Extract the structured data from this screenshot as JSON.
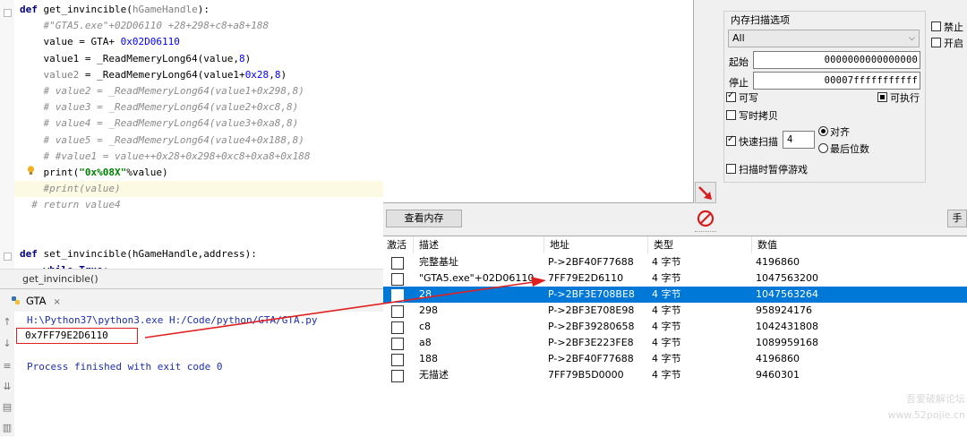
{
  "editor": {
    "lines": [
      [
        {
          "t": "def ",
          "c": "kw"
        },
        {
          "t": "get_invincible",
          "c": ""
        },
        {
          "t": "(",
          "c": ""
        },
        {
          "t": "hGameHandle",
          "c": "gr"
        },
        {
          "t": "):",
          "c": ""
        }
      ],
      [
        {
          "t": "    ",
          "c": ""
        },
        {
          "t": "#\"GTA5.exe\"+02D06110 +28+298+c8+a8+188",
          "c": "cm"
        }
      ],
      [
        {
          "t": "    value = GTA+ ",
          "c": ""
        },
        {
          "t": "0x02D06110",
          "c": "num"
        }
      ],
      [
        {
          "t": "    value1 = _ReadMemeryLong64(value,",
          "c": ""
        },
        {
          "t": "8",
          "c": "num"
        },
        {
          "t": ")",
          "c": ""
        }
      ],
      [
        {
          "t": "    ",
          "c": ""
        },
        {
          "t": "value2",
          "c": "gr"
        },
        {
          "t": " = _ReadMemeryLong64(value1+",
          "c": ""
        },
        {
          "t": "0x28",
          "c": "num"
        },
        {
          "t": ",",
          "c": ""
        },
        {
          "t": "8",
          "c": "num"
        },
        {
          "t": ")",
          "c": ""
        }
      ],
      [
        {
          "t": "    ",
          "c": ""
        },
        {
          "t": "# value2 = _ReadMemeryLong64(value1+0x298,8)",
          "c": "cm"
        }
      ],
      [
        {
          "t": "    ",
          "c": ""
        },
        {
          "t": "# value3 = _ReadMemeryLong64(value2+0xc8,8)",
          "c": "cm"
        }
      ],
      [
        {
          "t": "    ",
          "c": ""
        },
        {
          "t": "# value4 = _ReadMemeryLong64(value3+0xa8,8)",
          "c": "cm"
        }
      ],
      [
        {
          "t": "    ",
          "c": ""
        },
        {
          "t": "# value5 = _ReadMemeryLong64(value4+0x188,8)",
          "c": "cm"
        }
      ],
      [
        {
          "t": "    ",
          "c": ""
        },
        {
          "t": "# #value1 = value++0x28+0x298+0xc8+0xa8+0x188",
          "c": "cm"
        }
      ],
      [
        {
          "t": "    print(",
          "c": ""
        },
        {
          "t": "\"0x%08X\"",
          "c": "str"
        },
        {
          "t": "%value)",
          "c": ""
        }
      ],
      [
        {
          "t": "    ",
          "c": ""
        },
        {
          "t": "#print(value)",
          "c": "cm"
        }
      ],
      [
        {
          "t": "  ",
          "c": ""
        },
        {
          "t": "# return value4",
          "c": "cm"
        }
      ],
      [],
      [],
      [
        {
          "t": "def ",
          "c": "kw"
        },
        {
          "t": "set_invincible(hGameHandle,address):",
          "c": ""
        }
      ],
      [
        {
          "t": "    ",
          "c": ""
        },
        {
          "t": "while",
          "c": "kw"
        },
        {
          "t": " ",
          "c": ""
        },
        {
          "t": "True",
          "c": "kw"
        },
        {
          "t": ":",
          "c": ""
        }
      ]
    ],
    "breadcrumb": "get_invincible()"
  },
  "run": {
    "tab_label": "GTA",
    "tab_close": "×",
    "command": "H:\\Python37\\python3.exe H:/Code/python/GTA/GTA.py",
    "output_value": "0x7FF79E2D6110",
    "exit_message": "Process finished with exit code 0"
  },
  "ce": {
    "scan_options_title": "内存扫描选项",
    "memory_region": "All",
    "start_label": "起始",
    "start_value": "0000000000000000",
    "stop_label": "停止",
    "stop_value": "00007fffffffffff",
    "writable_label": "可写",
    "executable_label": "可执行",
    "copy_on_write_label": "写时拷贝",
    "fast_scan_label": "快速扫描",
    "fast_scan_value": "4",
    "align_label": "对齐",
    "last_digits_label": "最后位数",
    "pause_game_label": "扫描时暂停游戏",
    "disable_label": "禁止",
    "open_label": "开启",
    "view_memory_label": "查看内存",
    "right_button_label": "手",
    "columns": [
      "激活",
      "描述",
      "地址",
      "类型",
      "数值"
    ],
    "rows": [
      {
        "desc": "完整基址",
        "addr": "P->2BF40F77688",
        "type": "4 字节",
        "value": "4196860",
        "selected": false
      },
      {
        "desc": "\"GTA5.exe\"+02D06110",
        "addr": "7FF79E2D6110",
        "type": "4 字节",
        "value": "1047563200",
        "selected": false
      },
      {
        "desc": "28",
        "addr": "P->2BF3E708BE8",
        "type": "4 字节",
        "value": "1047563264",
        "selected": true
      },
      {
        "desc": "298",
        "addr": "P->2BF3E708E98",
        "type": "4 字节",
        "value": "958924176",
        "selected": false
      },
      {
        "desc": "c8",
        "addr": "P->2BF39280658",
        "type": "4 字节",
        "value": "1042431808",
        "selected": false
      },
      {
        "desc": "a8",
        "addr": "P->2BF3E223FE8",
        "type": "4 字节",
        "value": "1089959168",
        "selected": false
      },
      {
        "desc": "188",
        "addr": "P->2BF40F77688",
        "type": "4 字节",
        "value": "4196860",
        "selected": false
      },
      {
        "desc": "无描述",
        "addr": "7FF79B5D0000",
        "type": "4 字节",
        "value": "9460301",
        "selected": false
      }
    ],
    "watermark_line1": "吾爱破解论坛",
    "watermark_line2": "www.52pojie.cn"
  },
  "colors": {
    "annotation": "#e02020",
    "selection": "#0078d7"
  }
}
